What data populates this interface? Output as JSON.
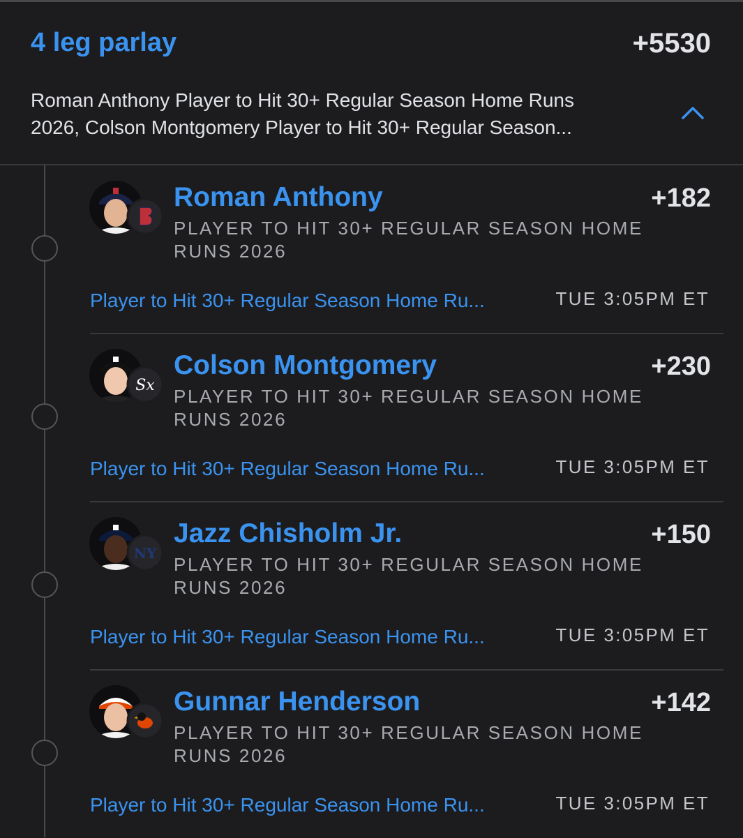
{
  "parlay": {
    "title": "4 leg parlay",
    "odds": "+5530",
    "summary_line1": "Roman Anthony Player to Hit 30+ Regular Season Home Runs",
    "summary_line2": "2026, Colson Montgomery Player to Hit 30+ Regular Season..."
  },
  "legs": [
    {
      "player": "Roman Anthony",
      "odds": "+182",
      "market": "PLAYER TO HIT 30+ REGULAR SEASON HOME RUNS 2026",
      "link": "Player to Hit 30+ Regular Season Home Ru...",
      "time": "TUE 3:05PM ET",
      "team_icon": "red-sox-logo-icon",
      "team_color": "#bd3039"
    },
    {
      "player": "Colson Montgomery",
      "odds": "+230",
      "market": "PLAYER TO HIT 30+ REGULAR SEASON HOME RUNS 2026",
      "link": "Player to Hit 30+ Regular Season Home Ru...",
      "time": "TUE 3:05PM ET",
      "team_icon": "white-sox-logo-icon",
      "team_color": "#ffffff"
    },
    {
      "player": "Jazz Chisholm Jr.",
      "odds": "+150",
      "market": "PLAYER TO HIT 30+ REGULAR SEASON HOME RUNS 2026",
      "link": "Player to Hit 30+ Regular Season Home Ru...",
      "time": "TUE 3:05PM ET",
      "team_icon": "yankees-logo-icon",
      "team_color": "#1f3a78"
    },
    {
      "player": "Gunnar Henderson",
      "odds": "+142",
      "market": "PLAYER TO HIT 30+ REGULAR SEASON HOME RUNS 2026",
      "link": "Player to Hit 30+ Regular Season Home Ru...",
      "time": "TUE 3:05PM ET",
      "team_icon": "orioles-logo-icon",
      "team_color": "#df4601"
    }
  ],
  "colors": {
    "accent": "#3b93f0",
    "background": "#1c1c1e",
    "text": "#e2e4e8",
    "muted": "#a9abb0"
  },
  "icons": {
    "collapse": "chevron-up-icon"
  }
}
